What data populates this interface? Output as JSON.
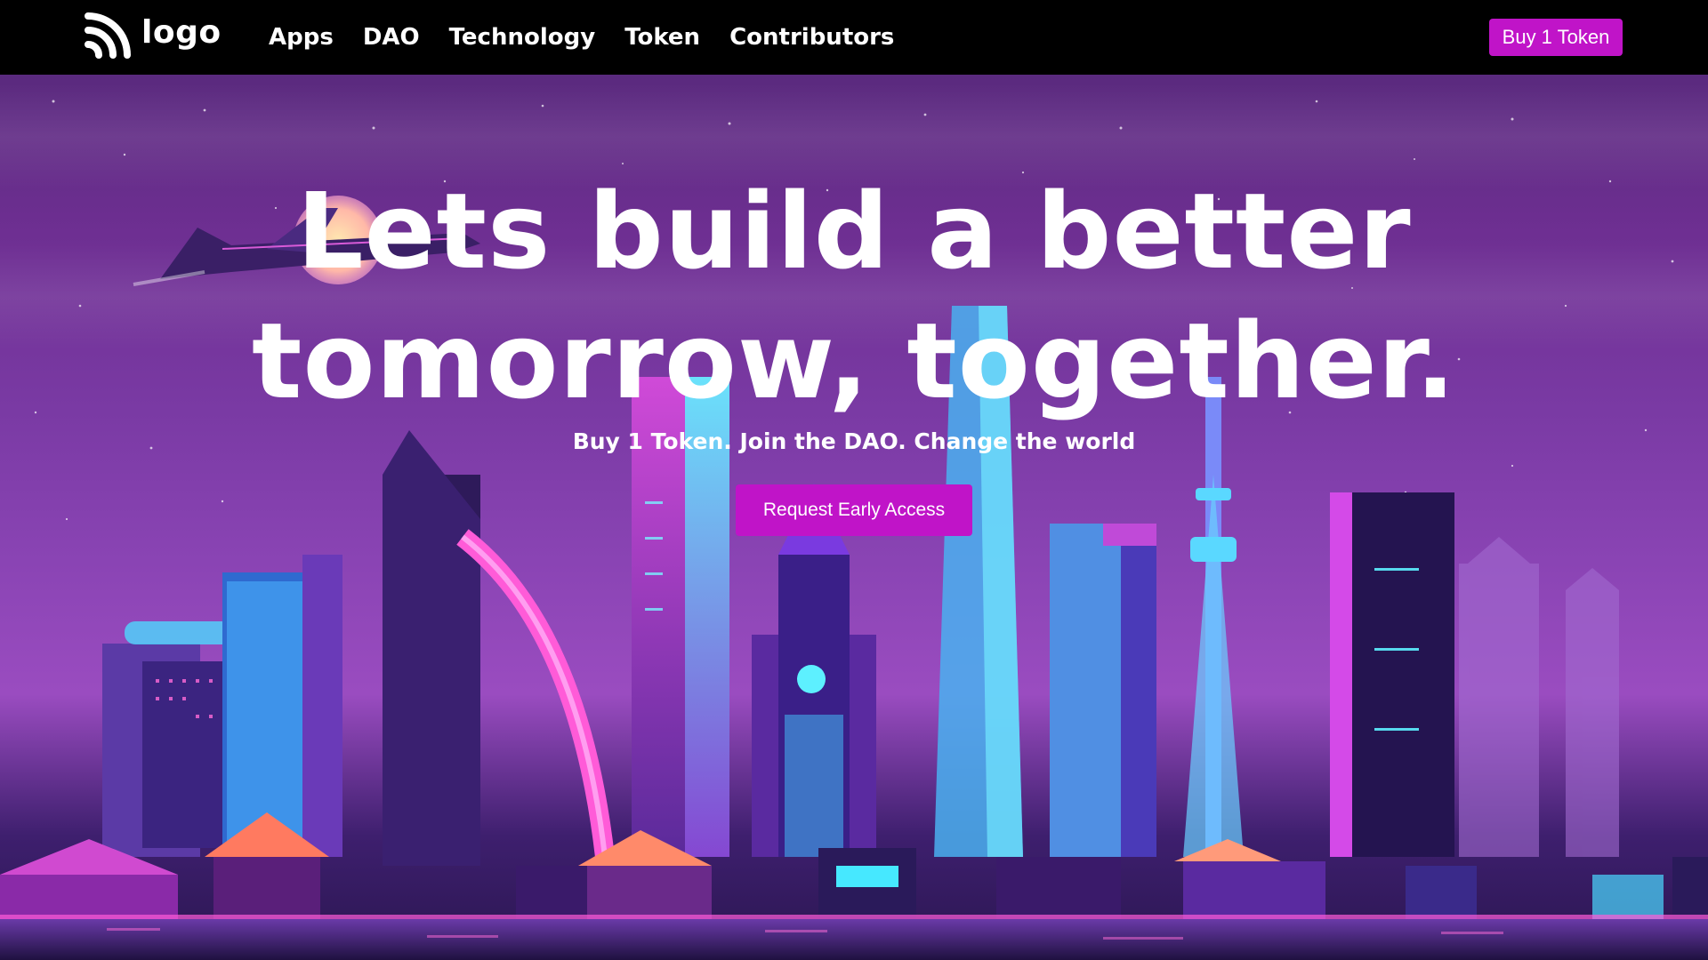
{
  "nav": {
    "logo_text": "logo",
    "links": [
      "Apps",
      "DAO",
      "Technology",
      "Token",
      "Contributors"
    ],
    "buy_button": "Buy 1 Token"
  },
  "hero": {
    "headline_line1": "Lets build a better",
    "headline_line2": "tomorrow, together.",
    "subheadline": "Buy 1 Token. Join the DAO. Change the world",
    "cta": "Request Early Access"
  },
  "colors": {
    "accent": "#c014c8",
    "navbar": "#000000",
    "sky_top": "#5a2a7e",
    "sky_mid": "#8a44b4"
  },
  "icons": {
    "logo": "rss-feed-icon",
    "illustration": "neon-city-skyline"
  }
}
